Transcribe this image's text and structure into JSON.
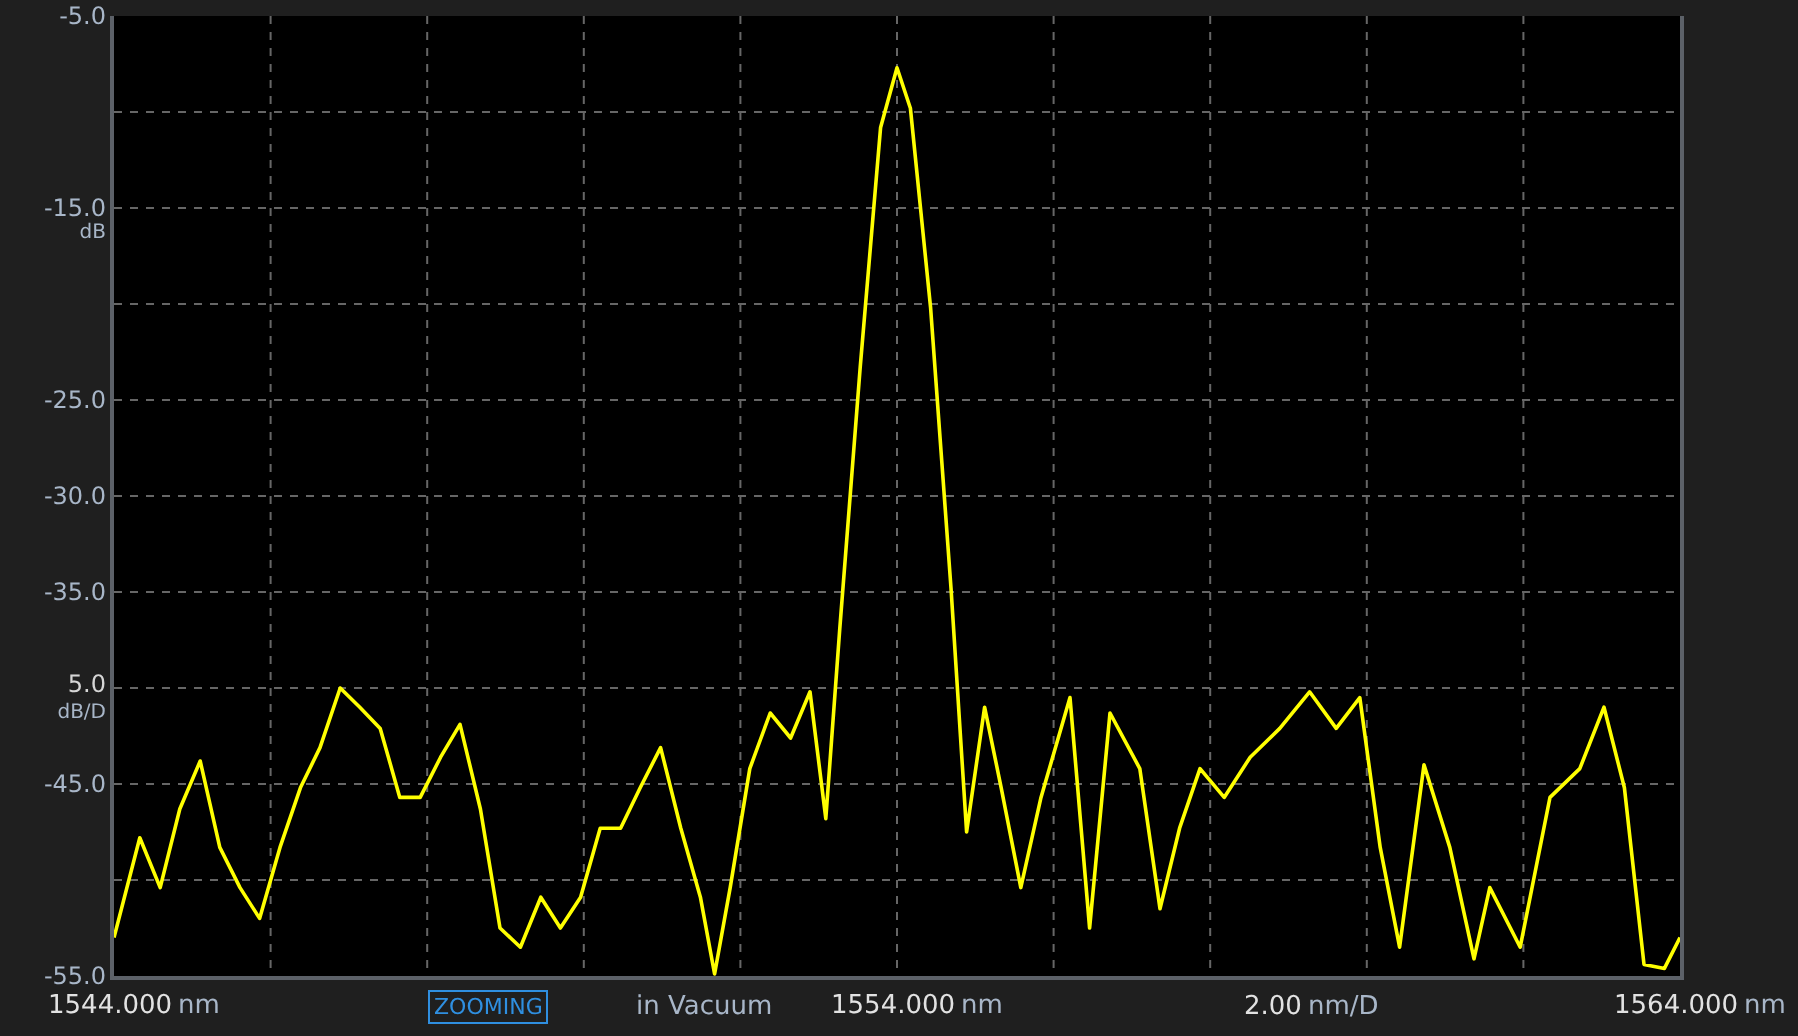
{
  "chart_data": {
    "type": "line",
    "grid": true,
    "xlim": [
      1544,
      1564
    ],
    "ylim": [
      -55,
      -5
    ],
    "xticks": [
      {
        "value": 1544,
        "label": "1544.000"
      },
      {
        "value": 1554,
        "label": "1554.000"
      },
      {
        "value": 1564,
        "label": "1564.000"
      }
    ],
    "yticks": [
      {
        "value": -5,
        "label": "-5.0"
      },
      {
        "value": -15,
        "label": "-15.0"
      },
      {
        "value": -25,
        "label": "-25.0"
      },
      {
        "value": -30,
        "label": "-30.0"
      },
      {
        "value": -35,
        "label": "-35.0"
      },
      {
        "value": -45,
        "label": "-45.0"
      },
      {
        "value": -55,
        "label": "-55.0"
      }
    ],
    "x": [
      1544.0,
      1544.33,
      1544.59,
      1544.84,
      1545.1,
      1545.35,
      1545.61,
      1545.86,
      1546.12,
      1546.38,
      1546.63,
      1546.89,
      1547.14,
      1547.4,
      1547.65,
      1547.91,
      1548.17,
      1548.42,
      1548.68,
      1548.93,
      1549.19,
      1549.45,
      1549.7,
      1549.96,
      1550.21,
      1550.47,
      1550.72,
      1550.98,
      1551.24,
      1551.49,
      1551.67,
      1551.87,
      1552.12,
      1552.38,
      1552.64,
      1552.89,
      1553.09,
      1553.27,
      1553.53,
      1553.79,
      1554.0,
      1554.17,
      1554.43,
      1554.69,
      1554.89,
      1555.12,
      1555.33,
      1555.58,
      1555.84,
      1556.21,
      1556.46,
      1556.72,
      1557.1,
      1557.36,
      1557.61,
      1557.87,
      1558.18,
      1558.51,
      1558.89,
      1559.27,
      1559.61,
      1559.91,
      1560.17,
      1560.42,
      1560.73,
      1561.06,
      1561.37,
      1561.57,
      1561.96,
      1562.34,
      1562.72,
      1563.03,
      1563.29,
      1563.54,
      1563.8,
      1564.0
    ],
    "series": [
      {
        "color": "#ffff00",
        "values": [
          -53.0,
          -47.8,
          -50.4,
          -46.3,
          -43.8,
          -48.3,
          -50.4,
          -52.0,
          -48.3,
          -45.2,
          -43.1,
          -40.0,
          -41.0,
          -42.1,
          -45.7,
          -45.7,
          -43.6,
          -41.9,
          -46.3,
          -52.5,
          -53.5,
          -50.9,
          -52.5,
          -50.9,
          -47.3,
          -47.3,
          -45.2,
          -43.1,
          -47.3,
          -50.9,
          -54.9,
          -50.4,
          -44.2,
          -41.3,
          -42.6,
          -40.2,
          -46.8,
          -36.9,
          -23.3,
          -10.8,
          -7.7,
          -9.8,
          -20.2,
          -34.8,
          -47.5,
          -41.0,
          -45.2,
          -50.4,
          -45.7,
          -40.5,
          -52.5,
          -41.3,
          -44.2,
          -51.5,
          -47.3,
          -44.2,
          -45.7,
          -43.6,
          -42.1,
          -40.2,
          -42.1,
          -40.5,
          -48.3,
          -53.5,
          -44.0,
          -48.3,
          -54.1,
          -50.4,
          -53.5,
          -45.7,
          -44.2,
          -41.0,
          -45.2,
          -54.4,
          -54.6,
          -53.0
        ]
      }
    ]
  },
  "y_unit": "dB",
  "scale": {
    "value": "5.0",
    "unit": "dB/D"
  },
  "x_units": [
    "nm",
    "nm",
    "nm"
  ],
  "bottom_bar": {
    "status": "ZOOMING",
    "medium": "in Vacuum",
    "span": {
      "value": "2.00",
      "unit": "nm/D"
    }
  }
}
